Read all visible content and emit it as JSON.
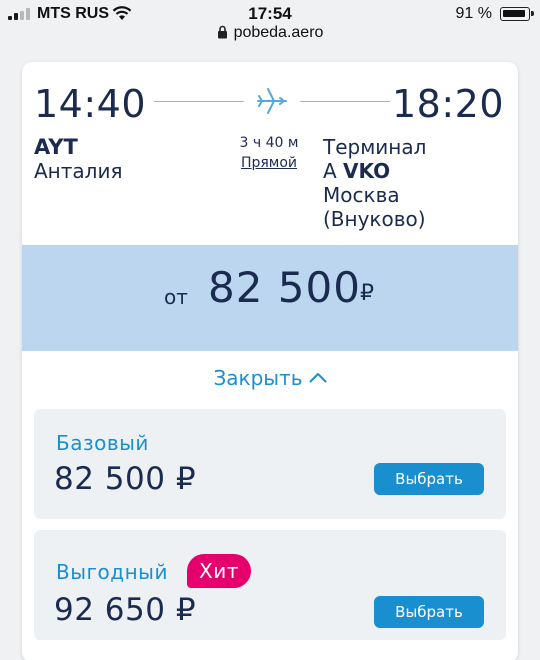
{
  "status_bar": {
    "carrier": "MTS RUS",
    "time": "17:54",
    "battery": "91 %",
    "battery_level": 0.91
  },
  "url_bar": {
    "url": "pobeda.aero",
    "icons": [
      "lock-icon"
    ]
  },
  "flight": {
    "departure_time": "14:40",
    "arrival_time": "18:20",
    "departure_code": "AYT",
    "departure_city": "Анталия",
    "duration": "3 ч 40 м",
    "type_link": "Прямой",
    "arrival_terminal_label": "Терминал",
    "arrival_terminal": "A",
    "arrival_code": "VKO",
    "arrival_city_line1": "Москва",
    "arrival_city_line2": "(Внуково)",
    "icon": "plane-icon"
  },
  "price_summary": {
    "prefix": "от",
    "amount": "82 500",
    "currency": "₽"
  },
  "toggle": {
    "label": "Закрыть"
  },
  "fares": [
    {
      "name": "Базовый",
      "price": "82 500 ₽",
      "button": "Выбрать"
    },
    {
      "name": "Выгодный",
      "badge": "Хит",
      "price": "92 650 ₽",
      "button": "Выбрать"
    }
  ],
  "colors": {
    "accent": "#1a8fcf",
    "text": "#1b2b4f",
    "price_band": "#bcd6f0",
    "badge": "#e6006e"
  }
}
